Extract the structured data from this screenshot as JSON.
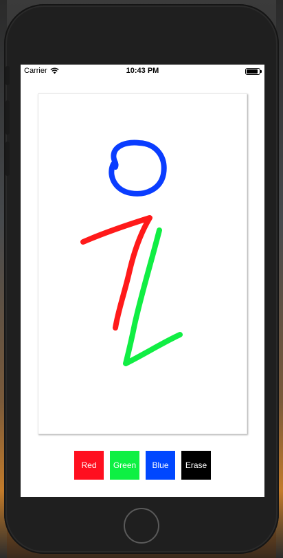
{
  "status_bar": {
    "carrier": "Carrier",
    "time": "10:43 PM",
    "wifi_icon": "wifi-icon",
    "battery_icon": "battery-icon",
    "battery_level_fraction": 0.9
  },
  "drawing": {
    "strokes": [
      {
        "color": "#0a3dff",
        "name": "blue-circle-stroke"
      },
      {
        "color": "#ff1a1a",
        "name": "red-stroke"
      },
      {
        "color": "#11ee44",
        "name": "green-stroke"
      }
    ]
  },
  "toolbar": {
    "buttons": [
      {
        "label": "Red",
        "color": "#ff0f1f"
      },
      {
        "label": "Green",
        "color": "#0ef043"
      },
      {
        "label": "Blue",
        "color": "#0047ff"
      },
      {
        "label": "Erase",
        "color": "#000000"
      }
    ]
  }
}
